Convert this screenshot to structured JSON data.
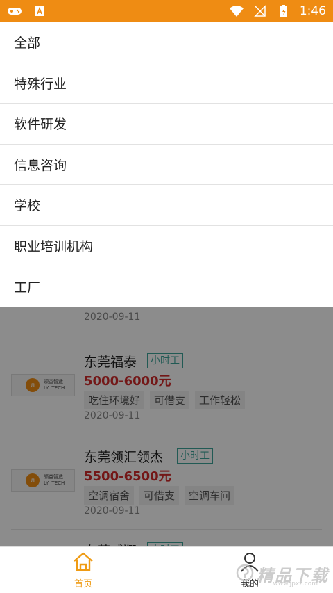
{
  "status_bar": {
    "time": "1:46",
    "icons": [
      "gamepad-icon",
      "a-box-icon",
      "wifi-icon",
      "no-sim-icon",
      "battery-charging-icon"
    ]
  },
  "dropdown": {
    "items": [
      "全部",
      "特殊行业",
      "软件研发",
      "信息咨询",
      "学校",
      "职业培训机构",
      "工厂"
    ]
  },
  "jobs": [
    {
      "date": "2020-09-11"
    },
    {
      "name": "东莞福泰",
      "badge": "小时工",
      "salary": "5000-6000元",
      "tags": [
        "吃住环境好",
        "可借支",
        "工作轻松"
      ],
      "date": "2020-09-11",
      "logo_text": [
        "领益智造",
        "LY iTECH"
      ]
    },
    {
      "name": "东莞领汇领杰",
      "badge": "小时工",
      "salary": "5500-6500元",
      "tags": [
        "空调宿舍",
        "可借支",
        "空调车间"
      ],
      "date": "2020-09-11",
      "logo_text": [
        "领益智造",
        "LY iTECH"
      ]
    },
    {
      "name": "东莞威翔",
      "badge": "小时工"
    }
  ],
  "bottom_nav": {
    "home_label": "首页",
    "me_label": "我的"
  },
  "watermark": {
    "text": "精品下载",
    "sub": "www.jpxz.com"
  },
  "colors": {
    "accent": "#ef8c13",
    "salary": "#d12b2b",
    "badge": "#3ca59a",
    "home_active": "#ef9b14"
  }
}
